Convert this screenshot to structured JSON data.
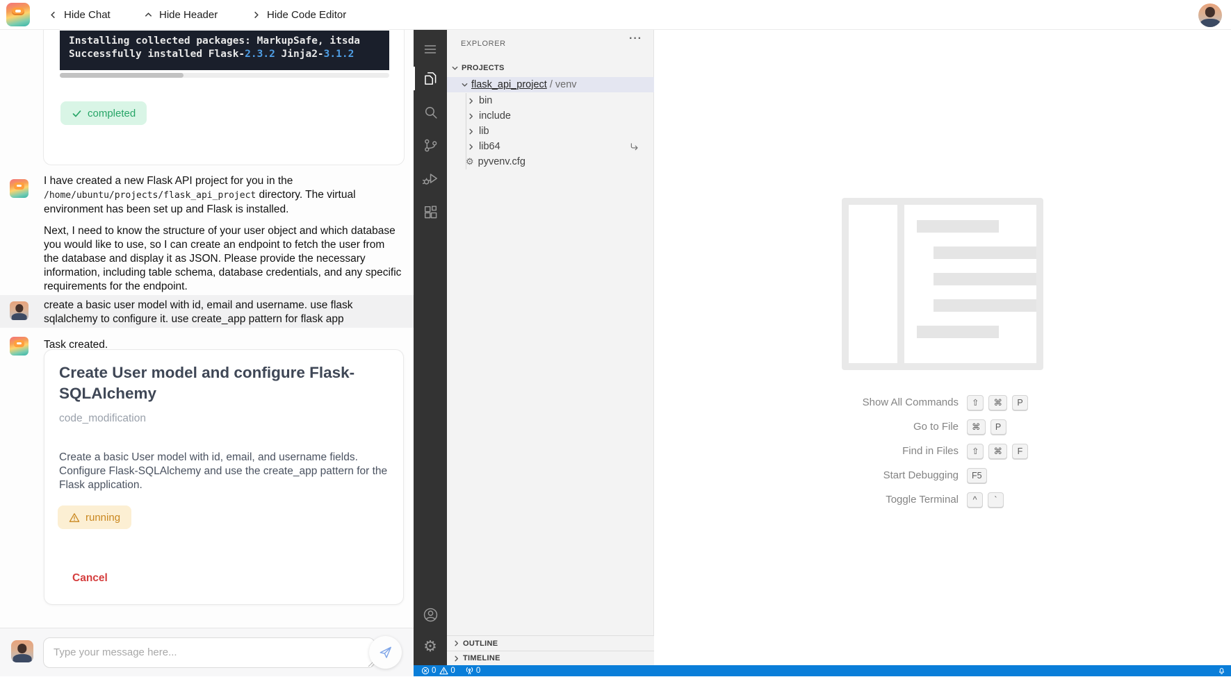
{
  "header": {
    "hide_chat": "Hide Chat",
    "hide_header": "Hide Header",
    "hide_code_editor": "Hide Code Editor"
  },
  "chat": {
    "terminal": {
      "line1": "Installing collected packages: MarkupSafe, itsda",
      "l2a": "Successfully installed Flask-",
      "l2b": "2.3.2",
      "l2c": " Jinja2-",
      "l2d": "3.1.2"
    },
    "completed_badge": "completed",
    "assistant_msg1": {
      "p1a": "I have created a new Flask API project for you in the ",
      "p1_code": "/home/ubuntu/projects/flask_api_project",
      "p1b": " directory. The virtual environment has been set up and Flask is installed.",
      "p2": "Next, I need to know the structure of your user object and which database you would like to use, so I can create an endpoint to fetch the user from the database and display it as JSON. Please provide the necessary information, including table schema, database credentials, and any specific requirements for the endpoint."
    },
    "user_msg": "create a basic user model with id, email and username. use flask sqlalchemy to configure it. use create_app pattern for flask app",
    "task_created": "Task created.",
    "task_card": {
      "title": "Create User model and configure Flask-SQLAlchemy",
      "type": "code_modification",
      "description": "Create a basic User model with id, email, and username fields. Configure Flask-SQLAlchemy and use the create_app pattern for the Flask application.",
      "status": "running",
      "cancel_label": "Cancel"
    },
    "input_placeholder": "Type your message here..."
  },
  "editor": {
    "explorer": {
      "title": "EXPLORER",
      "projects_label": "PROJECTS",
      "root_name": "flask_api_project",
      "root_suffix": "/ venv",
      "tree": [
        {
          "label": "bin"
        },
        {
          "label": "include"
        },
        {
          "label": "lib"
        },
        {
          "label": "lib64"
        },
        {
          "label": "pyvenv.cfg"
        }
      ],
      "outline_label": "OUTLINE",
      "timeline_label": "TIMELINE"
    },
    "shortcuts": [
      {
        "label": "Show All Commands",
        "keys": [
          "⇧",
          "⌘",
          "P"
        ]
      },
      {
        "label": "Go to File",
        "keys": [
          "⌘",
          "P"
        ]
      },
      {
        "label": "Find in Files",
        "keys": [
          "⇧",
          "⌘",
          "F"
        ]
      },
      {
        "label": "Start Debugging",
        "keys": [
          "F5"
        ]
      },
      {
        "label": "Toggle Terminal",
        "keys": [
          "^",
          "`"
        ]
      }
    ],
    "status_bar": {
      "errors": "0",
      "warnings": "0",
      "ports": "0"
    }
  },
  "colors": {
    "status_bar_blue": "#0a7ed9",
    "completed_green": "#27a567",
    "running_orange": "#c9871f",
    "cancel_red": "#d53e3e"
  }
}
